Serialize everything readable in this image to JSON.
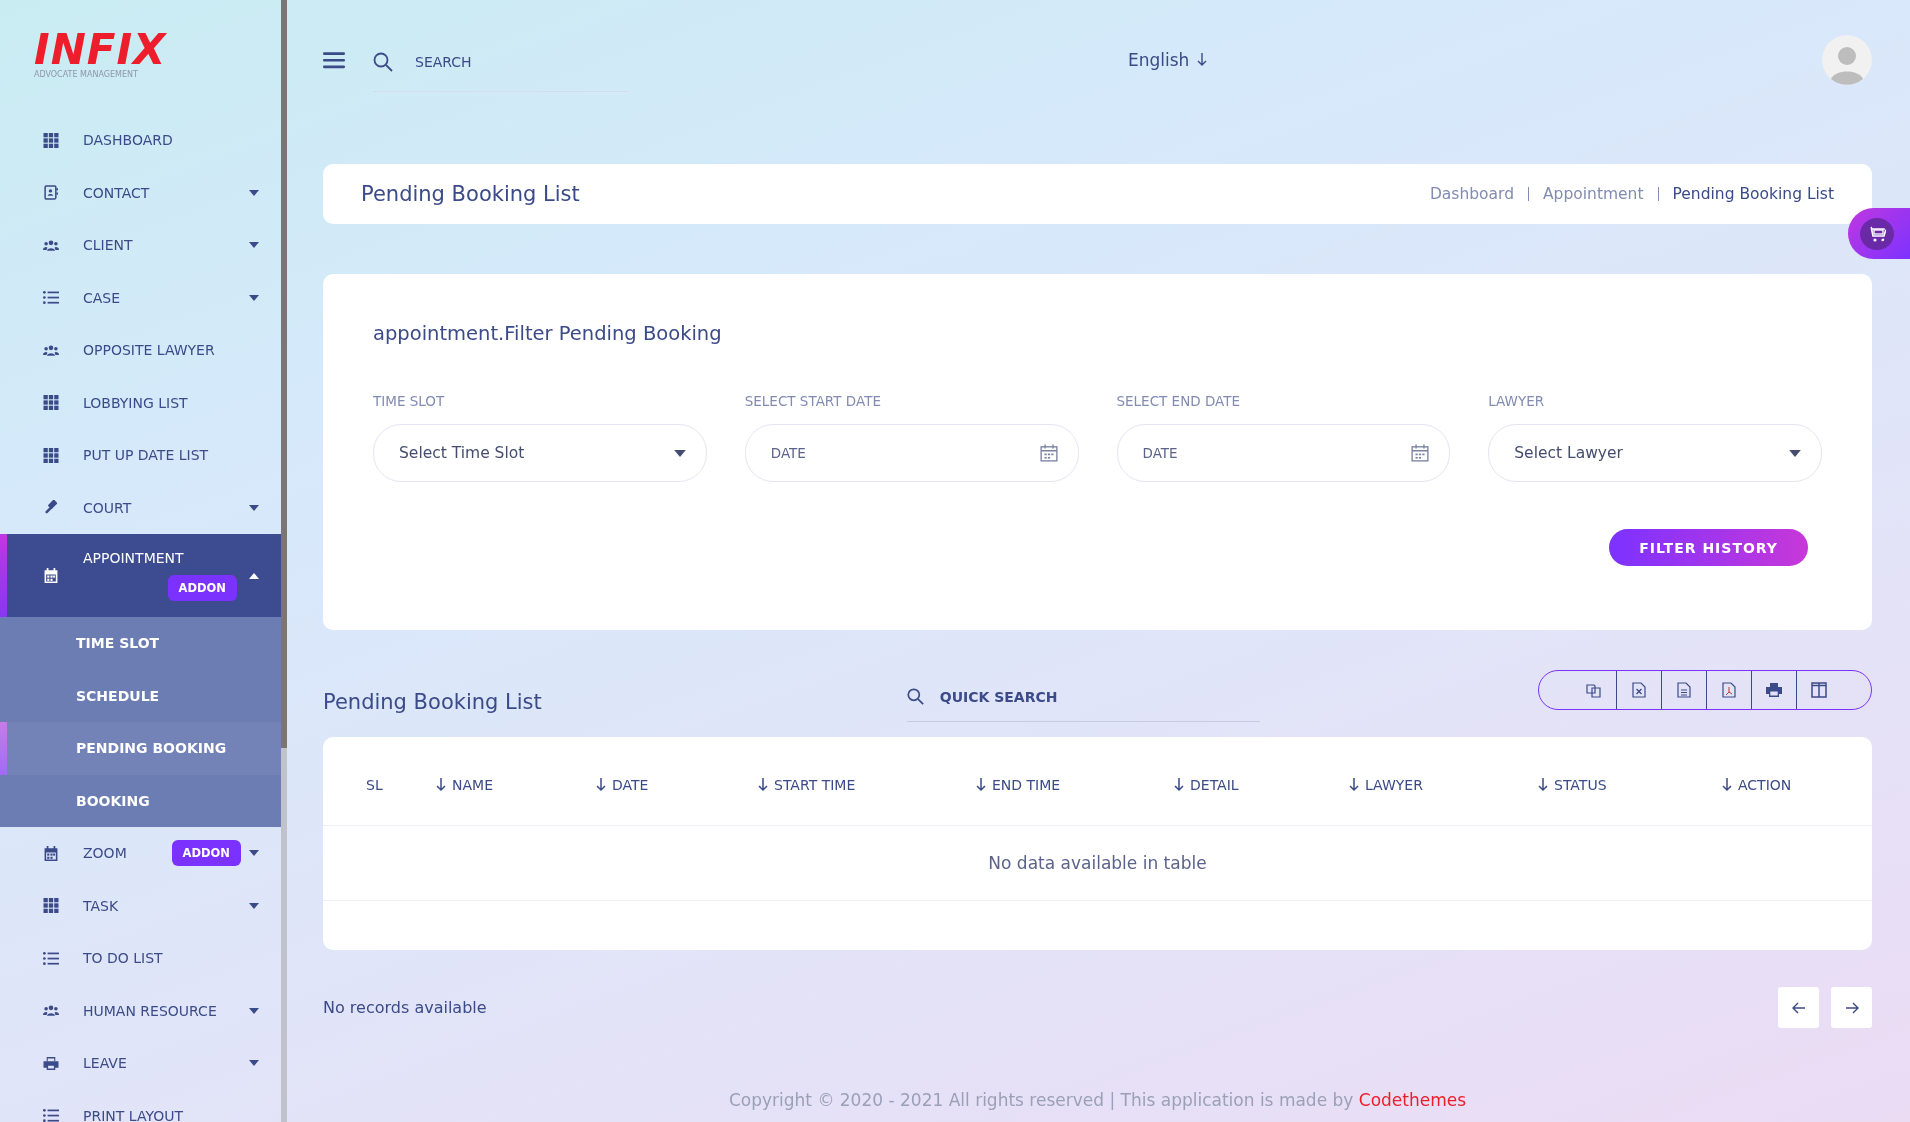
{
  "logo": {
    "name": "INFIX",
    "tagline": "ADVOCATE MANAGEMENT"
  },
  "sidebar": {
    "items": [
      {
        "label": "DASHBOARD",
        "kind": "link",
        "selected": false
      },
      {
        "label": "CONTACT",
        "kind": "menu",
        "expanded": false,
        "selected": false
      },
      {
        "label": "CLIENT",
        "kind": "menu",
        "expanded": false,
        "selected": false
      },
      {
        "label": "CASE",
        "kind": "menu",
        "expanded": false,
        "selected": false
      },
      {
        "label": "OPPOSITE LAWYER",
        "kind": "link",
        "selected": false
      },
      {
        "label": "LOBBYING LIST",
        "kind": "link",
        "selected": false
      },
      {
        "label": "PUT UP DATE LIST",
        "kind": "link",
        "selected": false
      },
      {
        "label": "COURT",
        "kind": "menu",
        "expanded": false,
        "selected": false
      },
      {
        "label": "APPOINTMENT",
        "kind": "menu",
        "expanded": true,
        "selected": true,
        "badge": "ADDON",
        "children": [
          {
            "label": "TIME SLOT",
            "selected": false
          },
          {
            "label": "SCHEDULE",
            "selected": false
          },
          {
            "label": "PENDING BOOKING",
            "selected": true
          },
          {
            "label": "BOOKING",
            "selected": false
          }
        ]
      },
      {
        "label": "ZOOM",
        "kind": "menu",
        "expanded": false,
        "selected": false,
        "badge": "ADDON"
      },
      {
        "label": "TASK",
        "kind": "menu",
        "expanded": false,
        "selected": false
      },
      {
        "label": "TO DO LIST",
        "kind": "link",
        "selected": false
      },
      {
        "label": "HUMAN RESOURCE",
        "kind": "menu",
        "expanded": false,
        "selected": false
      },
      {
        "label": "LEAVE",
        "kind": "menu",
        "expanded": false,
        "selected": false
      },
      {
        "label": "PRINT LAYOUT",
        "kind": "link",
        "selected": false
      }
    ]
  },
  "topbar": {
    "search": {
      "placeholder": "SEARCH"
    },
    "language": "English"
  },
  "page_header": {
    "title": "Pending Booking List",
    "breadcrumbs": [
      "Dashboard",
      "Appointment",
      "Pending Booking List"
    ]
  },
  "filter": {
    "title": "appointment.Filter Pending Booking",
    "fields": [
      {
        "label": "TIME SLOT",
        "kind": "select",
        "placeholder": "Select Time Slot"
      },
      {
        "label": "SELECT START DATE",
        "kind": "date",
        "placeholder": "DATE"
      },
      {
        "label": "SELECT END DATE",
        "kind": "date",
        "placeholder": "DATE"
      },
      {
        "label": "LAWYER",
        "kind": "select",
        "placeholder": "Select Lawyer"
      }
    ],
    "button": "FILTER HISTORY"
  },
  "list": {
    "title": "Pending Booking List",
    "search": {
      "placeholder": "QUICK SEARCH"
    },
    "table": {
      "columns": [
        {
          "label": "SL",
          "sortable": false
        },
        {
          "label": "NAME",
          "sortable": true
        },
        {
          "label": "DATE",
          "sortable": true
        },
        {
          "label": "START TIME",
          "sortable": true
        },
        {
          "label": "END TIME",
          "sortable": true
        },
        {
          "label": "DETAIL",
          "sortable": true
        },
        {
          "label": "LAWYER",
          "sortable": true
        },
        {
          "label": "STATUS",
          "sortable": true
        },
        {
          "label": "ACTION",
          "sortable": true
        }
      ],
      "empty_message": "No data available in table"
    },
    "records_info": "No records available"
  },
  "footer": {
    "text": "Copyright © 2020 - 2021 All rights reserved | This application is made by ",
    "link": "Codethemes"
  }
}
